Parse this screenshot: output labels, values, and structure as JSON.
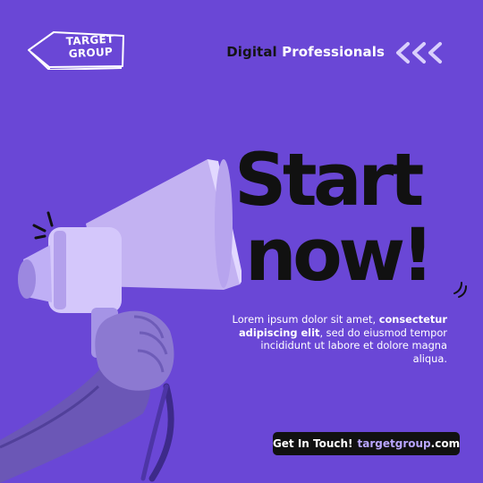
{
  "brand": {
    "logo_text": "TARGET GROUP",
    "logo_line1": "TARGET",
    "logo_line2": "GROUP"
  },
  "header": {
    "label_part1": "Digital",
    "label_part2": "Professionals",
    "icon": "triple-chevron-left-icon"
  },
  "headline": {
    "line1": "Start",
    "line2": "now!"
  },
  "body": {
    "text_pre": "Lorem ipsum dolor sit amet, ",
    "text_bold": "consectetur adipiscing elit",
    "text_post": ", sed do eiusmod tempor incididunt ut labore et dolore magna aliqua."
  },
  "cta": {
    "label": "Get In Touch!",
    "domain": "targetgroup",
    "tld": ".com"
  },
  "illustration": {
    "subject": "megaphone-in-hand",
    "icon": "megaphone-icon"
  },
  "colors": {
    "background": "#6a47d6",
    "text_dark": "#111111",
    "accent_light": "#b9a6ff",
    "white": "#ffffff"
  }
}
